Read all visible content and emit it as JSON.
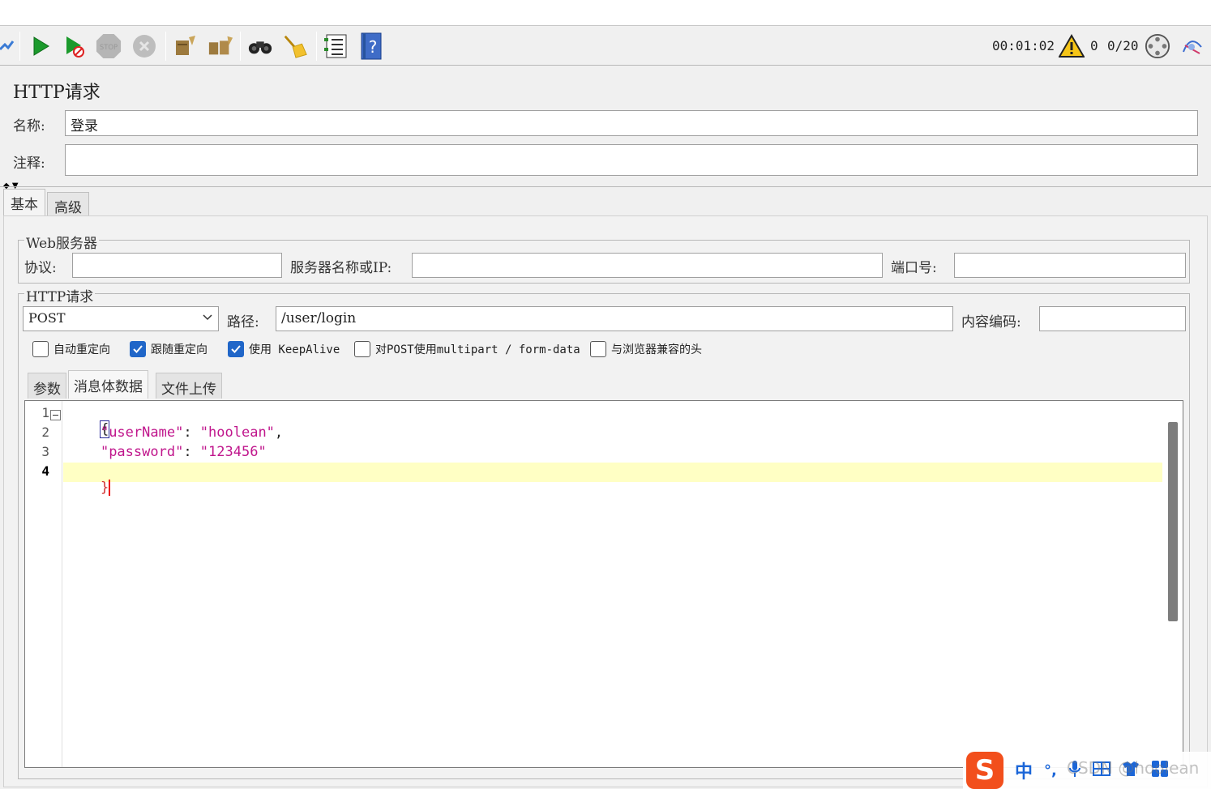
{
  "toolbar": {
    "icons": [
      "start-icon",
      "start-no-pause-icon",
      "stop-icon",
      "shutdown-icon",
      "clear-icon",
      "clear-all-icon",
      "search-icon",
      "reset-search-icon",
      "function-helper-icon",
      "help-icon"
    ],
    "timer": "00:01:02",
    "warning_count": "0",
    "threads": "0/20"
  },
  "form": {
    "title": "HTTP请求",
    "name_label": "名称:",
    "name_value": "登录",
    "comment_label": "注释:",
    "comment_value": ""
  },
  "tabs": {
    "basic": "基本",
    "advanced": "高级"
  },
  "web_server": {
    "group_title": "Web服务器",
    "protocol_label": "协议:",
    "protocol_value": "",
    "server_label": "服务器名称或IP:",
    "server_value": "",
    "port_label": "端口号:",
    "port_value": ""
  },
  "http_request": {
    "group_title": "HTTP请求",
    "method": "POST",
    "path_label": "路径:",
    "path_value": "/user/login",
    "encoding_label": "内容编码:",
    "encoding_value": "",
    "options": [
      {
        "label": "自动重定向",
        "checked": false
      },
      {
        "label": "跟随重定向",
        "checked": true
      },
      {
        "label": "使用 KeepAlive",
        "checked": true
      },
      {
        "label": "对POST使用multipart / form-data",
        "checked": false
      },
      {
        "label": "与浏览器兼容的头",
        "checked": false
      }
    ]
  },
  "subtabs": {
    "params": "参数",
    "body": "消息体数据",
    "files": "文件上传"
  },
  "editor": {
    "line_numbers": [
      "1",
      "2",
      "3",
      "4"
    ],
    "lines": {
      "l1": "{",
      "l2_key": "\"userName\"",
      "l2_colon": ": ",
      "l2_value": "\"hoolean\"",
      "l2_comma": ",",
      "l3_key": "\"password\"",
      "l3_colon": ": ",
      "l3_value": "\"123456\"",
      "l4": "}"
    },
    "string_color": "#c0168c",
    "current_line_color": "#ffffc4"
  },
  "ime": {
    "logo": "S",
    "mode": "中",
    "punct": "°,",
    "watermark": "CSDN @hoolean"
  }
}
